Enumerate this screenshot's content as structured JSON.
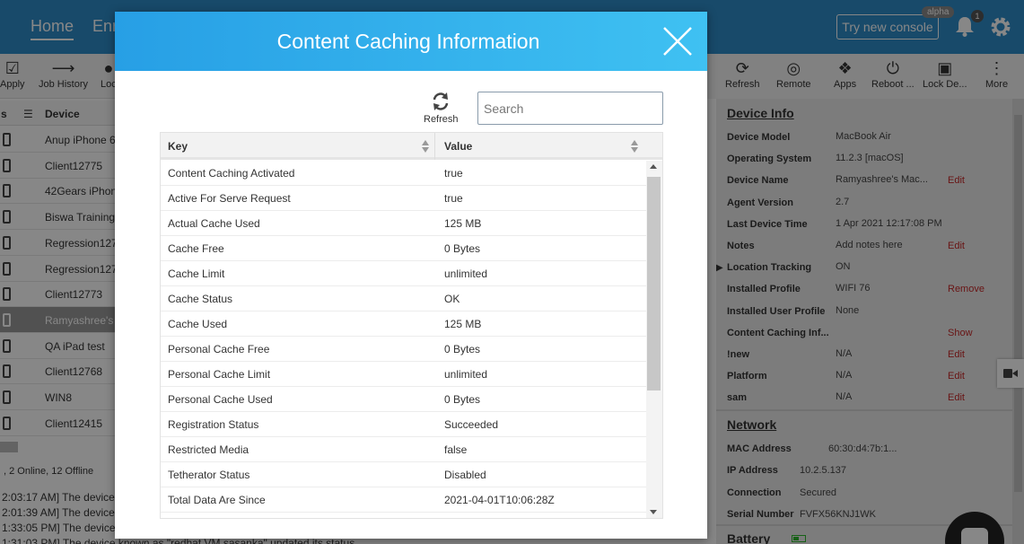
{
  "nav": {
    "home": "Home",
    "enroll": "Enr"
  },
  "header": {
    "try_console": "Try new console",
    "alpha_badge": "alpha",
    "notification_count": "1"
  },
  "toolbar_left": [
    "Apply",
    "Job History",
    "Loc"
  ],
  "toolbar_right": [
    "Refresh",
    "Remote",
    "Apps",
    "Reboot ...",
    "Lock De...",
    "More"
  ],
  "device_list": {
    "sort_label": "s",
    "column_header": "Device",
    "items": [
      "Anup iPhone 6",
      "Client12775",
      "42Gears iPhon",
      "Biswa Training",
      "Regression127",
      "Regression127",
      "Client12773",
      "Ramyashree's",
      "QA iPad test",
      "Client12768",
      "WIN8",
      "Client12415"
    ],
    "selected_index": 7,
    "status": ", 2 Online, 12 Offline"
  },
  "logs": [
    "2:03:17 AM] The device",
    "2:01:39 AM] The device",
    "1:33:05 PM] The device",
    "1:31:03 PM] The device known as \"redhat VM sasanka\" updated its status"
  ],
  "device_info": {
    "title": "Device Info",
    "rows": [
      {
        "key": "Device Model",
        "value": "MacBook Air",
        "action": ""
      },
      {
        "key": "Operating System",
        "value": "11.2.3 [macOS]",
        "action": ""
      },
      {
        "key": "Device Name",
        "value": "Ramyashree's Mac...",
        "action": "Edit"
      },
      {
        "key": "Agent Version",
        "value": "2.7",
        "action": ""
      },
      {
        "key": "Last Device Time",
        "value": "1 Apr 2021 12:17:08 PM",
        "action": ""
      },
      {
        "key": "Notes",
        "value": "Add notes here",
        "action": "Edit"
      },
      {
        "key": "Location Tracking",
        "value": "ON",
        "action": ""
      },
      {
        "key": "Installed Profile",
        "value": "WIFI 76",
        "action": "Remove"
      },
      {
        "key": "Installed User Profile",
        "value": "None",
        "action": ""
      },
      {
        "key": "Content Caching Inf...",
        "value": "",
        "action": "Show"
      },
      {
        "key": "!new",
        "value": "N/A",
        "action": "Edit"
      },
      {
        "key": "Platform",
        "value": "N/A",
        "action": "Edit"
      },
      {
        "key": "sam",
        "value": "N/A",
        "action": "Edit"
      }
    ]
  },
  "network": {
    "title": "Network",
    "rows": [
      {
        "key": "MAC Address",
        "value": "60:30:d4:7b:1..."
      },
      {
        "key": "IP Address",
        "value": "10.2.5.137"
      },
      {
        "key": "Connection",
        "value": "Secured"
      },
      {
        "key": "Serial Number",
        "value": "FVFX56KNJ1WK"
      }
    ]
  },
  "battery": {
    "title": "Battery"
  },
  "modal": {
    "title": "Content Caching Information",
    "refresh_label": "Refresh",
    "search_placeholder": "Search",
    "columns": {
      "key": "Key",
      "value": "Value"
    },
    "rows": [
      {
        "key": "Content Caching Activated",
        "value": "true"
      },
      {
        "key": "Active For Serve Request",
        "value": "true"
      },
      {
        "key": "Actual Cache Used",
        "value": "125 MB"
      },
      {
        "key": "Cache Free",
        "value": "0 Bytes"
      },
      {
        "key": "Cache Limit",
        "value": "unlimited"
      },
      {
        "key": "Cache Status",
        "value": "OK"
      },
      {
        "key": "Cache Used",
        "value": "125 MB"
      },
      {
        "key": "Personal Cache Free",
        "value": "0 Bytes"
      },
      {
        "key": "Personal Cache Limit",
        "value": "unlimited"
      },
      {
        "key": "Personal Cache Used",
        "value": "0 Bytes"
      },
      {
        "key": "Registration Status",
        "value": "Succeeded"
      },
      {
        "key": "Restricted Media",
        "value": "false"
      },
      {
        "key": "Tetherator Status",
        "value": "Disabled"
      },
      {
        "key": "Total Data Are Since",
        "value": "2021-04-01T10:06:28Z"
      }
    ]
  },
  "colors": {
    "topbar": "#2e8dc9",
    "modal_header_start": "#279fe5",
    "modal_header_end": "#3fc1f2",
    "action_red": "#c62828",
    "battery_green": "#2db82d"
  }
}
